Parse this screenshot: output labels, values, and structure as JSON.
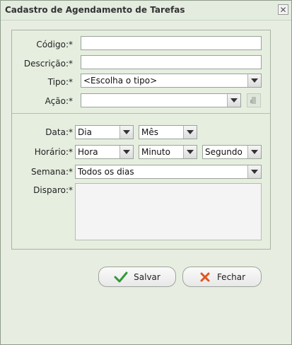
{
  "window": {
    "title": "Cadastro de Agendamento de Tarefas",
    "close_label": "✕"
  },
  "form": {
    "codigo": {
      "label": "Código:*",
      "value": ""
    },
    "descricao": {
      "label": "Descrição:*",
      "value": ""
    },
    "tipo": {
      "label": "Tipo:*",
      "value": "<Escolha o tipo>"
    },
    "acao": {
      "label": "Ação:*",
      "value": ""
    },
    "data": {
      "label": "Data:*",
      "dia": "Dia",
      "mes": "Mês"
    },
    "horario": {
      "label": "Horário:*",
      "hora": "Hora",
      "minuto": "Minuto",
      "segundo": "Segundo"
    },
    "semana": {
      "label": "Semana:*",
      "value": "Todos os dias"
    },
    "disparo": {
      "label": "Disparo:*",
      "value": ""
    }
  },
  "buttons": {
    "save_label": "Salvar",
    "close_label": "Fechar"
  },
  "icons": {
    "save": "check-icon",
    "close": "x-icon",
    "action": "action-icon"
  },
  "colors": {
    "background": "#e7eee1",
    "check": "#2f9a33",
    "x": "#e2541d"
  }
}
